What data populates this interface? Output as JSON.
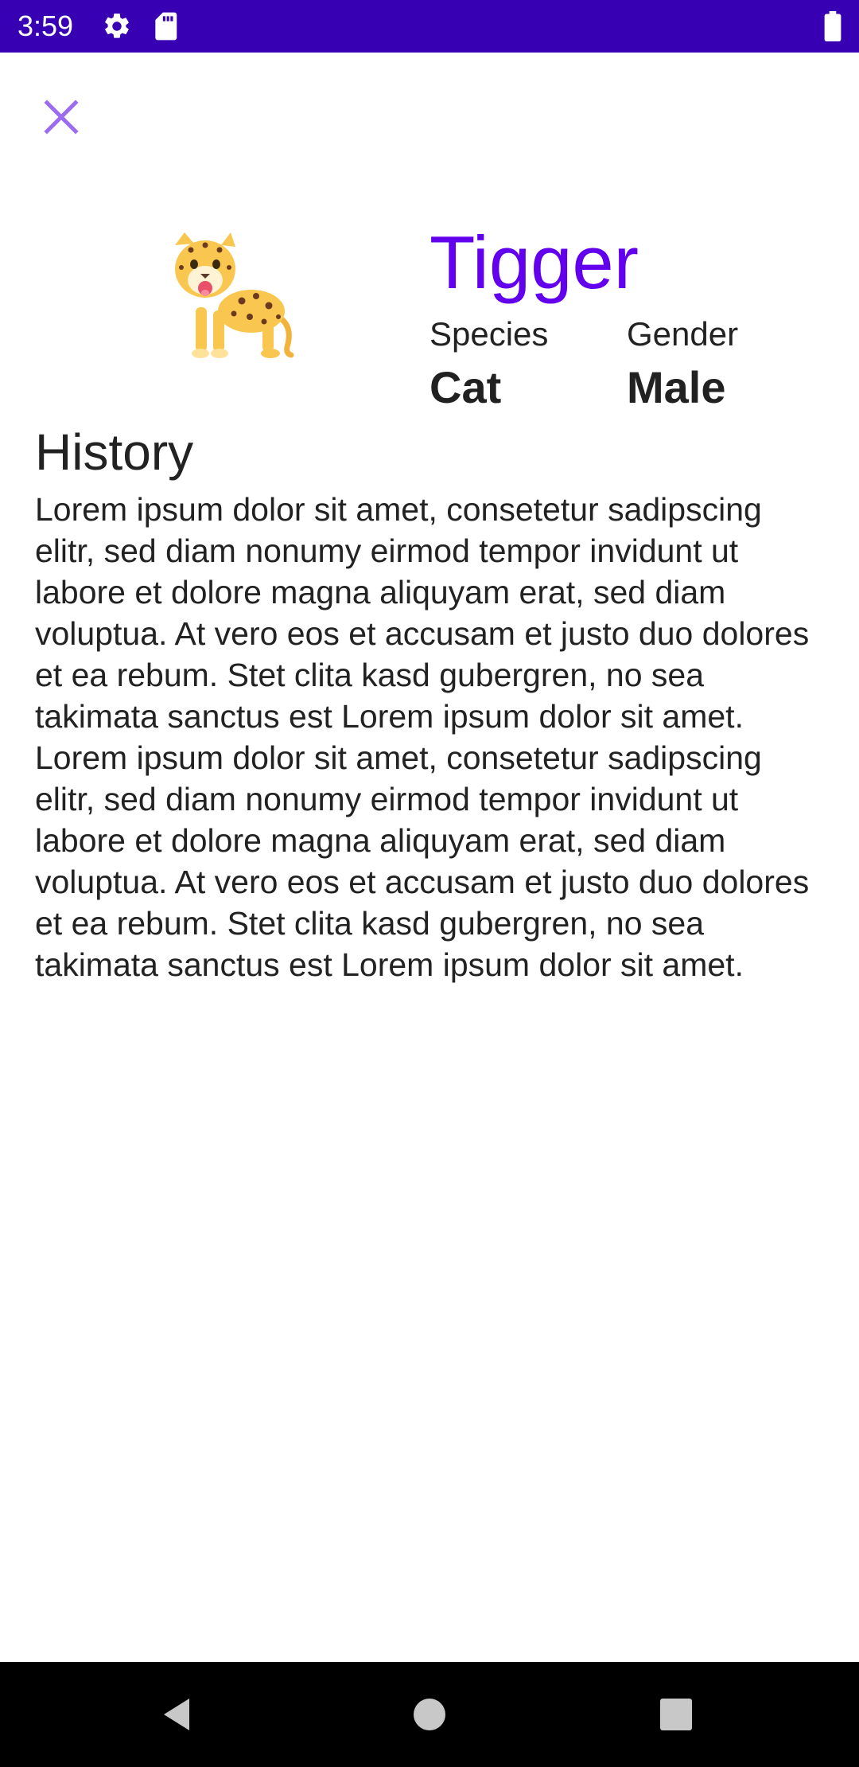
{
  "status_bar": {
    "time": "3:59",
    "background_color": "#3700B3",
    "icons": [
      "gear-icon",
      "sd-card-icon",
      "battery-icon"
    ]
  },
  "toolbar": {
    "close_icon": "close-icon",
    "close_color": "#9C6CF0"
  },
  "pet": {
    "image_icon": "leopard-emoji-icon",
    "name": "Tigger",
    "accent_color": "#6200EE",
    "species_label": "Species",
    "species_value": "Cat",
    "gender_label": "Gender",
    "gender_value": "Male"
  },
  "history": {
    "title": "History",
    "text": "Lorem ipsum dolor sit amet, consetetur sadipscing elitr, sed diam nonumy eirmod tempor invidunt ut labore et dolore magna aliquyam erat, sed diam voluptua. At vero eos et accusam et justo duo dolores et ea rebum. Stet clita kasd gubergren, no sea takimata sanctus est Lorem ipsum dolor sit amet. Lorem ipsum dolor sit amet, consetetur sadipscing elitr, sed diam nonumy eirmod tempor invidunt ut labore et dolore magna aliquyam erat, sed diam voluptua. At vero eos et accusam et justo duo dolores et ea rebum. Stet clita kasd gubergren, no sea takimata sanctus est Lorem ipsum dolor sit amet."
  },
  "nav_bar": {
    "icons": [
      "back-icon",
      "home-icon",
      "recents-icon"
    ]
  }
}
